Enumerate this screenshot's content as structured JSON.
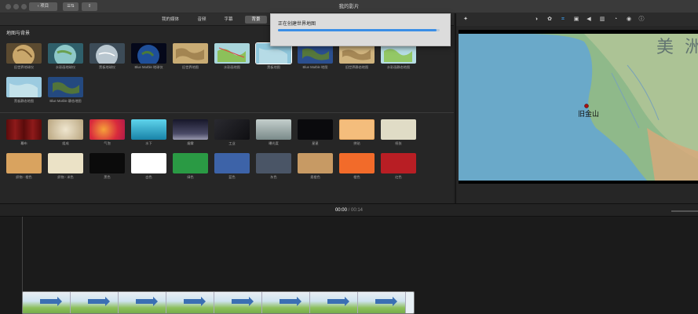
{
  "window": {
    "title": "我的影片",
    "back_button": "项目",
    "ratio_button": "☰⇅",
    "share_button": "⇪"
  },
  "media_tabs": [
    {
      "label": "我的媒体",
      "active": false
    },
    {
      "label": "音频",
      "active": false
    },
    {
      "label": "字幕",
      "active": false
    },
    {
      "label": "背景",
      "active": true
    }
  ],
  "section_title": "地图与背景",
  "maps": [
    {
      "label": "旧世界地球仪",
      "icon": "globe-old-icon"
    },
    {
      "label": "水彩画地球仪",
      "icon": "globe-watercolor-icon"
    },
    {
      "label": "黑板地球仪",
      "icon": "globe-chalk-icon"
    },
    {
      "label": "Blue Marble 地球仪",
      "icon": "globe-bluemarble-icon"
    },
    {
      "label": "旧世界地图",
      "icon": "map-old-icon"
    },
    {
      "label": "水彩画地图",
      "icon": "map-watercolor-icon"
    },
    {
      "label": "黑板地图",
      "icon": "map-chalk-icon"
    },
    {
      "label": "Blue Marble 地图",
      "icon": "map-bluemarble-icon"
    },
    {
      "label": "旧世界静态地图",
      "icon": "map-old-static-icon"
    },
    {
      "label": "水彩画静态地图",
      "icon": "map-watercolor-static-icon"
    },
    {
      "label": "黑板静态地图",
      "icon": "map-chalk-static-icon"
    },
    {
      "label": "Blue Marble 静态地图",
      "icon": "map-bluemarble-static-icon"
    }
  ],
  "backgrounds_row1": [
    {
      "label": "幕布",
      "color": "#7a1010"
    },
    {
      "label": "组成",
      "color": "#d9cdb0"
    },
    {
      "label": "气泡",
      "color": "#e0352d"
    },
    {
      "label": "水下",
      "color": "#20a8c8"
    },
    {
      "label": "烟雾",
      "color": "#3a3a4a"
    },
    {
      "label": "工业",
      "color": "#1b1b1f"
    },
    {
      "label": "曝光度",
      "color": "#9aa8a8"
    },
    {
      "label": "星星",
      "color": "#0d0d10"
    },
    {
      "label": "拼贴",
      "color": "#f4bd7c"
    },
    {
      "label": "纸张",
      "color": "#ddd8c0"
    }
  ],
  "backgrounds_row2": [
    {
      "label": "织物 - 橙色",
      "color": "#d7a05a"
    },
    {
      "label": "织物 - 米色",
      "color": "#e8dfc1"
    },
    {
      "label": "黑色",
      "color": "#0b0b0b"
    },
    {
      "label": "白色",
      "color": "#ffffff"
    },
    {
      "label": "绿色",
      "color": "#2a9a44"
    },
    {
      "label": "蓝色",
      "color": "#3d63a8"
    },
    {
      "label": "灰色",
      "color": "#4a5566"
    },
    {
      "label": "柔橙色",
      "color": "#c79a64"
    },
    {
      "label": "橙色",
      "color": "#f26b2a"
    },
    {
      "label": "红色",
      "color": "#b81e24"
    }
  ],
  "popup": {
    "text": "正在创建世界地图",
    "progress": 0.98
  },
  "viewer": {
    "map_label": "美 洲",
    "city_label": "旧金山",
    "tools": [
      "magic-wand-icon",
      "color-balance-icon",
      "color-palette-icon",
      "crop-icon",
      "camera-stabilize-icon",
      "volume-icon",
      "equalizer-icon",
      "speed-icon",
      "noise-reduction-icon",
      "info-icon"
    ]
  },
  "timeline": {
    "current": "00:00",
    "separator": "/",
    "total": "00:14",
    "frames": 8
  },
  "colors": {
    "accent": "#3fa7ff",
    "progress": "#3a8ee6"
  }
}
